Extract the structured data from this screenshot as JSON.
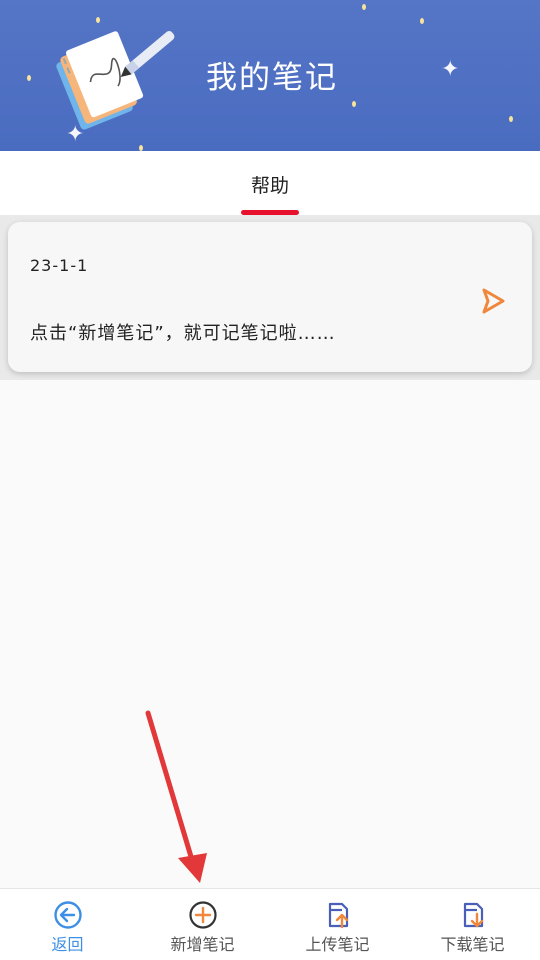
{
  "header": {
    "title": "我的笔记",
    "background_color": "#4f70c3"
  },
  "tabs": [
    {
      "label": "帮助",
      "active": true
    }
  ],
  "notes": [
    {
      "date": "23-1-1",
      "preview": "点击“新增笔记”，就可记笔记啦……"
    }
  ],
  "bottom_nav": [
    {
      "label": "返回",
      "icon": "back-arrow-icon",
      "active": true
    },
    {
      "label": "新增笔记",
      "icon": "add-circle-icon",
      "active": false
    },
    {
      "label": "上传笔记",
      "icon": "upload-note-icon",
      "active": false
    },
    {
      "label": "下载笔记",
      "icon": "download-note-icon",
      "active": false
    }
  ],
  "colors": {
    "accent_red": "#e8112d",
    "accent_orange": "#f0873a",
    "nav_blue": "#3d8fe6",
    "icon_blue": "#4a5fb8"
  }
}
